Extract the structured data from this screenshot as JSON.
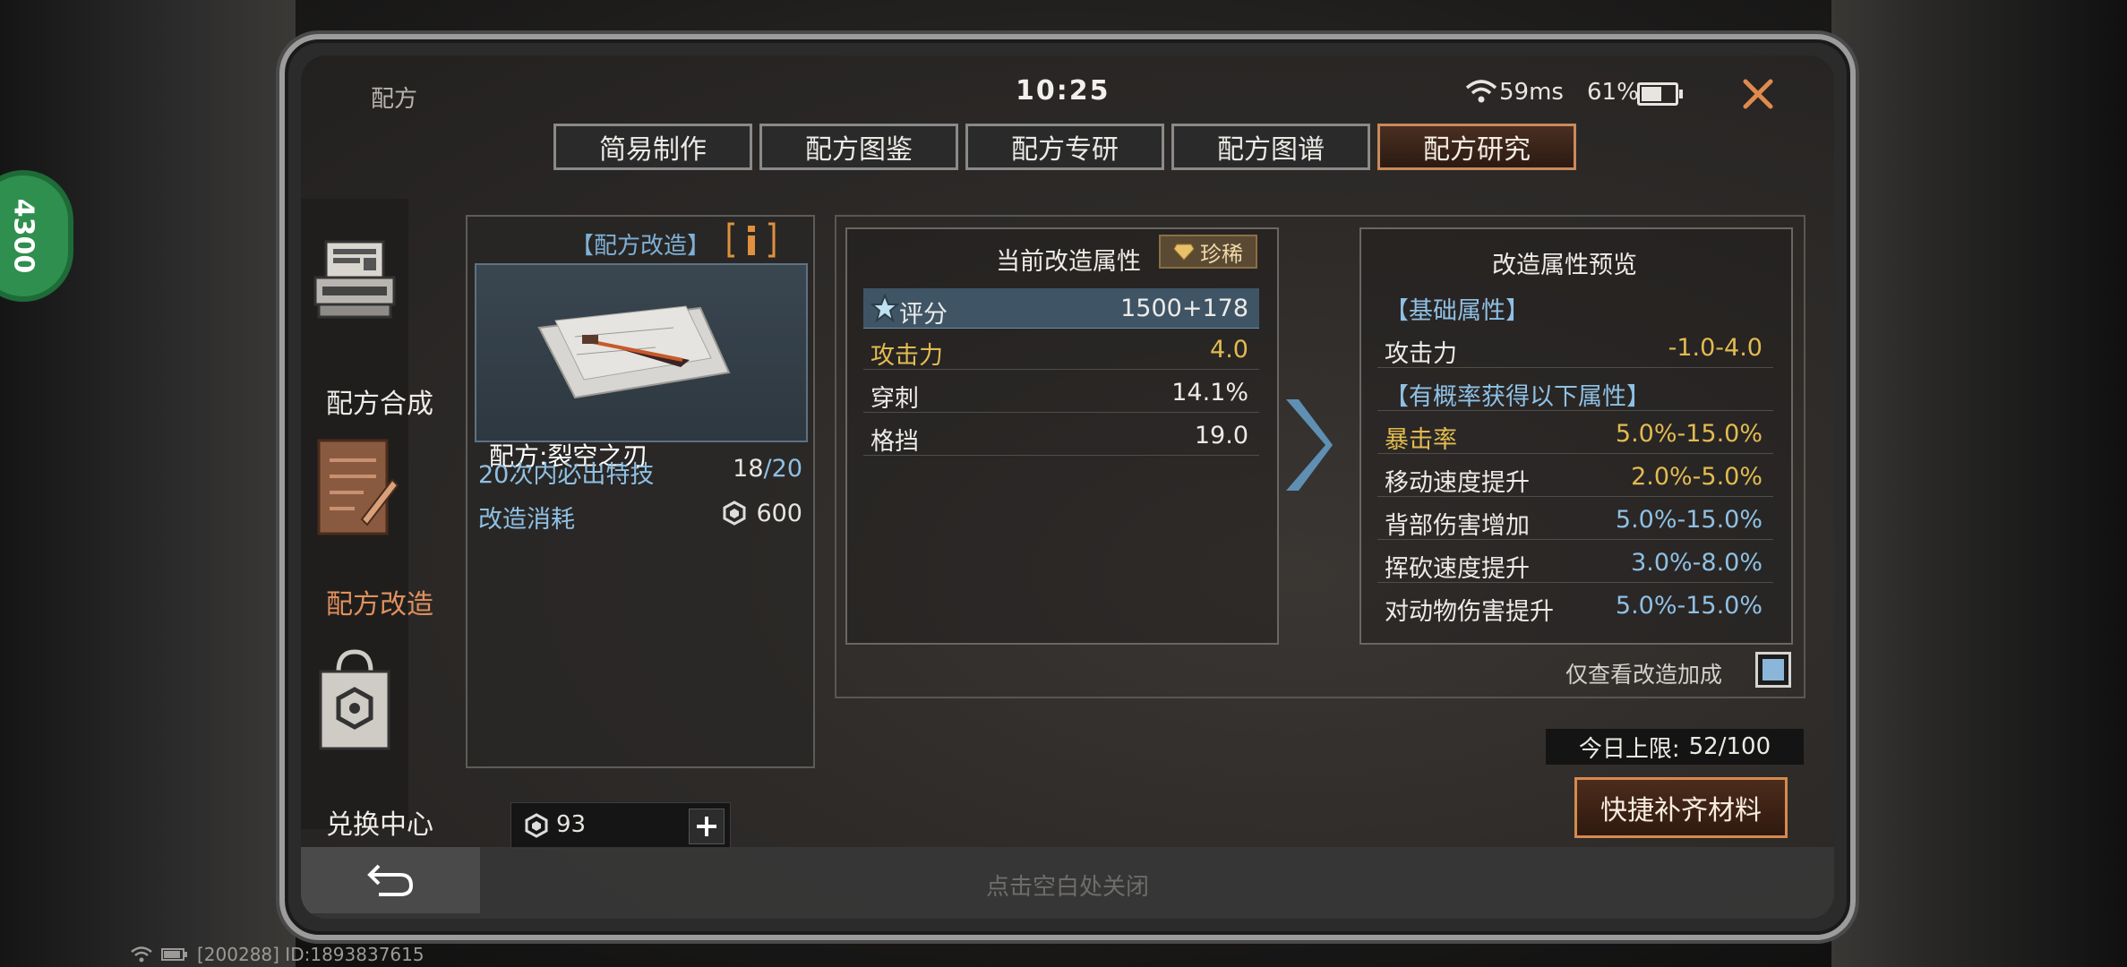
{
  "status_bar": {
    "title": "配方",
    "time": "10:25",
    "ping": "59ms",
    "battery": "61%"
  },
  "side_badge": "4300",
  "tabs": [
    {
      "label": "简易制作",
      "active": false
    },
    {
      "label": "配方图鉴",
      "active": false
    },
    {
      "label": "配方专研",
      "active": false
    },
    {
      "label": "配方图谱",
      "active": false
    },
    {
      "label": "配方研究",
      "active": true
    }
  ],
  "nav": [
    {
      "label": "配方合成",
      "icon": "printer-icon",
      "active": false
    },
    {
      "label": "配方改造",
      "icon": "notebook-pen-icon",
      "active": true
    },
    {
      "label": "兑换中心",
      "icon": "shopping-bag-icon",
      "active": false
    }
  ],
  "recipe": {
    "header": "【配方改造】",
    "name": "配方:裂空之刃",
    "guarantee_label": "20次内必出特技",
    "guarantee_current": "18",
    "guarantee_sep": "/",
    "guarantee_total": "20",
    "cost_label": "改造消耗",
    "cost_value": "600"
  },
  "currency": {
    "value": "93"
  },
  "current_attrs": {
    "title": "当前改造属性",
    "rarity": "珍稀",
    "rows": [
      {
        "label": "评分",
        "value": "1500+178"
      },
      {
        "label": "攻击力",
        "value": "4.0"
      },
      {
        "label": "穿刺",
        "value": "14.1%"
      },
      {
        "label": "格挡",
        "value": "19.0"
      }
    ]
  },
  "preview": {
    "title": "改造属性预览",
    "base_header": "【基础属性】",
    "base_rows": [
      {
        "label": "攻击力",
        "value": "-1.0-4.0"
      }
    ],
    "chance_header": "【有概率获得以下属性】",
    "chance_rows": [
      {
        "label": "暴击率",
        "value": "5.0%-15.0%"
      },
      {
        "label": "移动速度提升",
        "value": "2.0%-5.0%"
      },
      {
        "label": "背部伤害增加",
        "value": "5.0%-15.0%"
      },
      {
        "label": "挥砍速度提升",
        "value": "3.0%-8.0%"
      },
      {
        "label": "对动物伤害提升",
        "value": "5.0%-15.0%"
      }
    ]
  },
  "only_bonus_label": "仅查看改造加成",
  "daily_limit": {
    "label": "今日上限:",
    "value": "52/100"
  },
  "quick_fill_label": "快捷补齐材料",
  "close_hint": "点击空白处关闭",
  "system": {
    "info": "[200288] ID:1893837615"
  },
  "colors": {
    "accent_orange": "#d68a4e",
    "attr_gold": "#e2bb50",
    "attr_blue": "#8fc0e4",
    "highlight_row": "#3f5566"
  }
}
